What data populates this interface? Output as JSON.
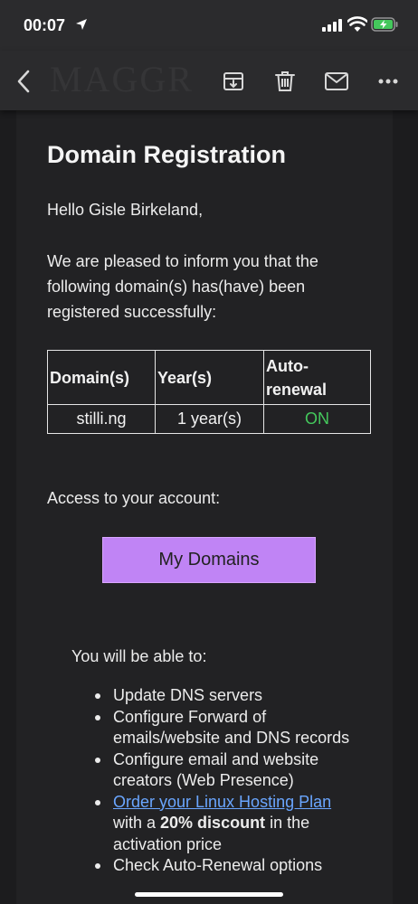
{
  "status_bar": {
    "time": "00:07"
  },
  "toolbar": {
    "icons": [
      "back-icon",
      "archive-icon",
      "trash-icon",
      "mail-icon",
      "more-icon"
    ],
    "watermark": "MAGGR"
  },
  "email": {
    "title": "Domain Registration",
    "greeting": "Hello Gisle Birkeland,",
    "intro": "We are pleased to inform you that the following domain(s) has(have) been registered successfully:",
    "table": {
      "headers": [
        "Domain(s)",
        "Year(s)",
        "Auto-renewal"
      ],
      "rows": [
        {
          "domain": "stilli.ng",
          "years": "1 year(s)",
          "auto_renewal": "ON"
        }
      ]
    },
    "access_text": "Access to your account:",
    "cta_label": "My Domains",
    "able_text": "You will be able to:",
    "features": [
      "Update DNS servers",
      "Configure Forward of emails/website and DNS records",
      "Configure email and website creators (Web Presence)",
      {
        "link": "Order your Linux Hosting Plan",
        "middle": " with a ",
        "bold": "20% discount",
        "end": " in the activation price"
      },
      "Check Auto-Renewal options"
    ]
  },
  "colors": {
    "accent_button": "#c084f5",
    "on_status": "#44c85c",
    "link": "#6aa6ff",
    "background": "#1c1c1e"
  }
}
